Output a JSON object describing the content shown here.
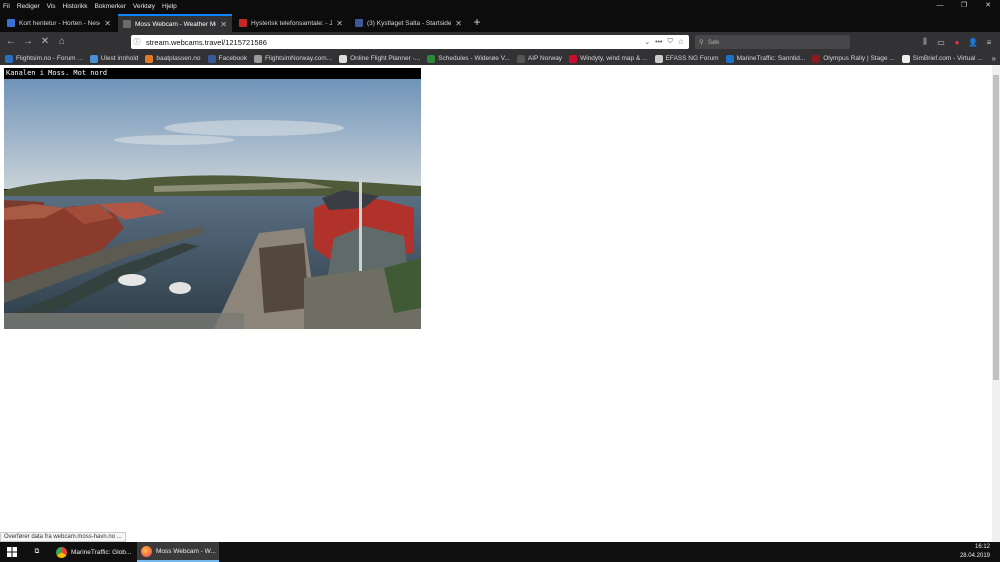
{
  "menu": [
    "Fil",
    "Rediger",
    "Vis",
    "Historikk",
    "Bokmerker",
    "Verktøy",
    "Hjelp"
  ],
  "window_controls": [
    "—",
    "❐",
    "✕"
  ],
  "tabs": [
    {
      "title": "Kort hentetur - Horten - Neson",
      "color": "#3b6fd4"
    },
    {
      "title": "Moss Webcam - Weather Moss",
      "color": "#6a6a6a"
    },
    {
      "title": "Hysterisk telefonsamtale: - Jeg",
      "color": "#c62828"
    },
    {
      "title": "(3) Kystlaget Salta - Startside",
      "color": "#3b5998"
    }
  ],
  "new_tab": "+",
  "nav": {
    "back": "←",
    "forward": "→",
    "stop": "✕",
    "home": "⌂"
  },
  "url": "stream.webcams.travel/1215721586",
  "url_icons": {
    "info": "ⓘ",
    "dropdown": "⌄",
    "more": "•••",
    "pocket": "⛉",
    "star": "☆"
  },
  "search_placeholder": "Søk",
  "search_icon": "⚲",
  "toolbar_right": [
    "⫼",
    "▭",
    "●",
    "👤",
    "≡"
  ],
  "bookmarks": [
    {
      "label": "Flightsim.no - Forum ...",
      "color": "#2c6fbd"
    },
    {
      "label": "Ulest innhold",
      "color": "#4a90d9"
    },
    {
      "label": "baatplassen.no",
      "color": "#e07b24"
    },
    {
      "label": "Facebook",
      "color": "#3b5998"
    },
    {
      "label": "FlightsimNorway.com...",
      "color": "#999999"
    },
    {
      "label": "Online Flight Planner -...",
      "color": "#dddddd"
    },
    {
      "label": "Schedules - Widerøe V...",
      "color": "#2a8a3a"
    },
    {
      "label": "AIP Norway",
      "color": "#555555"
    },
    {
      "label": "Windyty, wind map & ...",
      "color": "#c8102e"
    },
    {
      "label": "EFASS NG Forum",
      "color": "#cccccc"
    },
    {
      "label": "MarineTraffic: Sanntid...",
      "color": "#1a73c9"
    },
    {
      "label": "Olympus Rally | Stage ...",
      "color": "#8b1a1a"
    },
    {
      "label": "SimBrief.com - Virtual ...",
      "color": "#eeeeee"
    }
  ],
  "bookmarks_more": "»",
  "webcam_caption": "Kanalen i Moss. Mot nord",
  "status_text": "Overfører data fra webcam.moss-havn.no ...",
  "taskbar": {
    "start_icon": "windows-logo",
    "items": [
      {
        "label": "MarineTraffic: Glob...",
        "color": "#ea4335"
      },
      {
        "label": "Moss Webcam - W...",
        "color": "#ff7139"
      }
    ],
    "time": "16:12",
    "date": "28.04.2019"
  }
}
